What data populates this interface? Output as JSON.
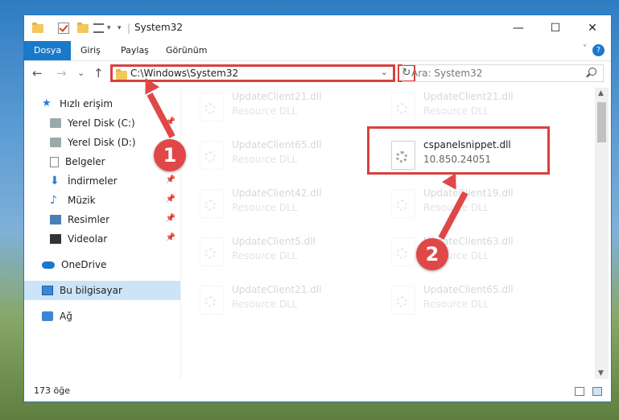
{
  "window": {
    "title": "System32"
  },
  "window_controls": {
    "minimize": "—",
    "maximize": "☐",
    "close": "✕"
  },
  "ribbon": {
    "tabs": [
      {
        "label": "Dosya"
      },
      {
        "label": "Giriş"
      },
      {
        "label": "Paylaş"
      },
      {
        "label": "Görünüm"
      }
    ],
    "help": "?"
  },
  "navigation": {
    "back": "←",
    "forward": "→",
    "recent": "⌄",
    "up": "↑",
    "address": "C:\\Windows\\System32",
    "refresh": "↻",
    "search_placeholder": "Ara: System32"
  },
  "sidebar": {
    "items": [
      {
        "label": "Hızlı erişim"
      },
      {
        "label": "Yerel Disk (C:)"
      },
      {
        "label": "Yerel Disk (D:)"
      },
      {
        "label": "Belgeler"
      },
      {
        "label": "İndirmeler"
      },
      {
        "label": "Müzik"
      },
      {
        "label": "Resimler"
      },
      {
        "label": "Videolar"
      },
      {
        "label": "OneDrive"
      },
      {
        "label": "Bu bilgisayar"
      },
      {
        "label": "Ağ"
      }
    ]
  },
  "files": [
    {
      "name": "UpdateClient21.dll",
      "desc": "Resource DLL"
    },
    {
      "name": "UpdateClient21.dll",
      "desc": "Resource DLL"
    },
    {
      "name": "UpdateClient65.dll",
      "desc": "Resource DLL"
    },
    {
      "name": "cspanelsnippet.dll",
      "desc": "10.850.24051"
    },
    {
      "name": "UpdateClient42.dll",
      "desc": "Resource DLL"
    },
    {
      "name": "UpdateClient19.dll",
      "desc": "Resource DLL"
    },
    {
      "name": "UpdateClient5.dll",
      "desc": "Resource DLL"
    },
    {
      "name": "UpdateClient63.dll",
      "desc": "Resource DLL"
    },
    {
      "name": "UpdateClient21.dll",
      "desc": "Resource DLL"
    },
    {
      "name": "UpdateClient65.dll",
      "desc": "Resource DLL"
    }
  ],
  "status": {
    "count": "173 öğe"
  },
  "callouts": {
    "one": "1",
    "two": "2"
  },
  "colors": {
    "accent": "#1979ca",
    "highlight": "#d94040",
    "selection": "#cce4f7"
  }
}
